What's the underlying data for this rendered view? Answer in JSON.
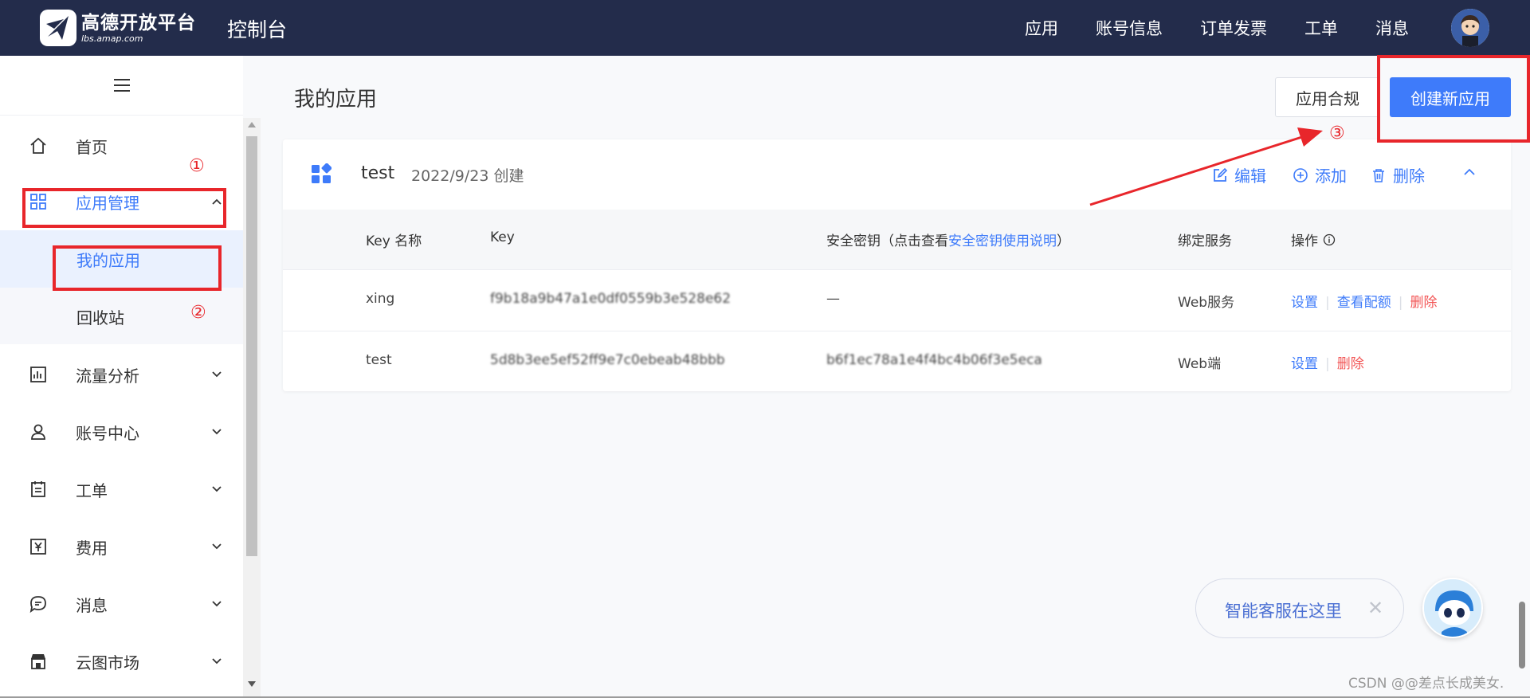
{
  "header": {
    "logo_name": "高德开放平台",
    "logo_url": "lbs.amap.com",
    "console_title": "控制台",
    "nav": [
      "应用",
      "账号信息",
      "订单发票",
      "工单",
      "消息"
    ]
  },
  "sidebar": {
    "items": [
      {
        "label": "首页",
        "icon": "home-icon"
      },
      {
        "label": "应用管理",
        "icon": "grid-icon",
        "expanded": true
      },
      {
        "label": "流量分析",
        "icon": "chart-icon"
      },
      {
        "label": "账号中心",
        "icon": "user-icon"
      },
      {
        "label": "工单",
        "icon": "clipboard-icon"
      },
      {
        "label": "费用",
        "icon": "yen-icon"
      },
      {
        "label": "消息",
        "icon": "message-icon"
      },
      {
        "label": "云图市场",
        "icon": "store-icon"
      }
    ],
    "sub_items": [
      {
        "label": "我的应用",
        "active": true
      },
      {
        "label": "回收站",
        "active": false
      }
    ]
  },
  "main": {
    "title": "我的应用",
    "compliance_button": "应用合规",
    "create_button": "创建新应用",
    "app": {
      "name": "test",
      "created": "2022/9/23 创建",
      "actions": {
        "edit": "编辑",
        "add": "添加",
        "delete": "删除"
      }
    },
    "table": {
      "headers": {
        "key_name": "Key 名称",
        "key": "Key",
        "secret_prefix": "安全密钥（点击查看",
        "secret_link": "安全密钥使用说明",
        "secret_suffix": "）",
        "service": "绑定服务",
        "ops": "操作"
      },
      "rows": [
        {
          "name": "xing",
          "key": "f9b18a9b47a1e0df0559b3e528e62",
          "secret": "—",
          "service": "Web服务",
          "ops": [
            "设置",
            "查看配额",
            "删除"
          ]
        },
        {
          "name": "test",
          "key": "5d8b3ee5ef52ff9e7c0ebeab48bbb",
          "secret": "b6f1ec78a1e4f4bc4b06f3e5eca",
          "service": "Web端",
          "ops": [
            "设置",
            "删除"
          ]
        }
      ]
    }
  },
  "chat": {
    "text": "智能客服在这里",
    "close": "✕"
  },
  "watermark": "CSDN @@差点长成美女.",
  "annotations": [
    "①",
    "②",
    "③"
  ],
  "colors": {
    "topbar": "#232c4b",
    "primary": "#3e7bfa",
    "danger": "#f25555",
    "annotation": "#e8262b"
  }
}
